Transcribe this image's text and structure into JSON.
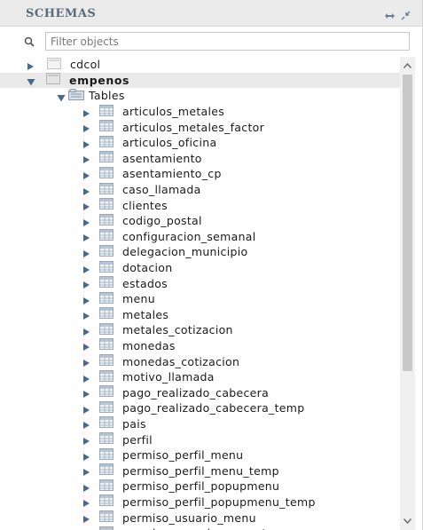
{
  "header": {
    "title": "SCHEMAS"
  },
  "filter": {
    "placeholder": "Filter objects",
    "value": ""
  },
  "tree": {
    "schemas": [
      {
        "label": "cdcol",
        "expanded": false
      },
      {
        "label": "empenos",
        "expanded": true,
        "selected": true
      }
    ],
    "tables_folder": {
      "label": "Tables",
      "expanded": true
    },
    "tables": [
      {
        "label": "articulos_metales"
      },
      {
        "label": "articulos_metales_factor"
      },
      {
        "label": "articulos_oficina"
      },
      {
        "label": "asentamiento"
      },
      {
        "label": "asentamiento_cp"
      },
      {
        "label": "caso_llamada"
      },
      {
        "label": "clientes"
      },
      {
        "label": "codigo_postal"
      },
      {
        "label": "configuracion_semanal"
      },
      {
        "label": "delegacion_municipio"
      },
      {
        "label": "dotacion"
      },
      {
        "label": "estados"
      },
      {
        "label": "menu"
      },
      {
        "label": "metales"
      },
      {
        "label": "metales_cotizacion"
      },
      {
        "label": "monedas"
      },
      {
        "label": "monedas_cotizacion"
      },
      {
        "label": "motivo_llamada"
      },
      {
        "label": "pago_realizado_cabecera"
      },
      {
        "label": "pago_realizado_cabecera_temp"
      },
      {
        "label": "pais"
      },
      {
        "label": "perfil"
      },
      {
        "label": "permiso_perfil_menu"
      },
      {
        "label": "permiso_perfil_menu_temp"
      },
      {
        "label": "permiso_perfil_popupmenu"
      },
      {
        "label": "permiso_perfil_popupmenu_temp"
      },
      {
        "label": "permiso_usuario_menu"
      },
      {
        "label": "permiso_usuario_menu_temp"
      }
    ]
  },
  "colors": {
    "header_bg": "#ebebeb",
    "header_title": "#5a6b7a",
    "selected_row": "#e9e9e9",
    "arrow": "#4a6a8a",
    "table_icon": "#9aa8b8",
    "scroll_thumb": "#c8c8c8"
  },
  "icons": {
    "header_refresh": "refresh-icon",
    "header_collapse": "collapse-icon",
    "filter": "search-icon",
    "expand": "triangle-right-icon",
    "collapse": "triangle-down-icon",
    "schema": "database-icon",
    "folder": "folder-icon",
    "table": "table-icon"
  }
}
